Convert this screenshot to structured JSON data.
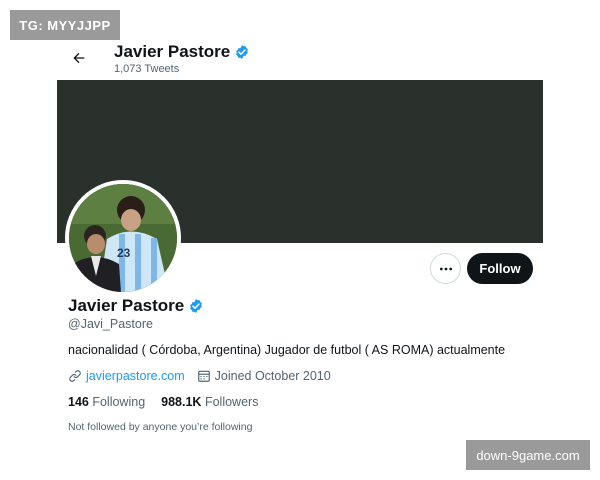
{
  "watermarks": {
    "top_left": "TG: MYYJJPP",
    "bottom_right": "down-9game.com"
  },
  "header": {
    "back_icon": "arrow-left-icon",
    "name": "Javier Pastore",
    "tweets_count": "1,073 Tweets",
    "verified_icon": "verified-badge-icon"
  },
  "profile": {
    "name": "Javier Pastore",
    "handle": "@Javi_Pastore",
    "bio": "nacionalidad ( Córdoba, Argentina) Jugador de futbol ( AS ROMA) actualmente",
    "website": "javierpastore.com",
    "joined": "Joined October 2010",
    "following_count": "146",
    "following_label": "Following",
    "followers_count": "988.1K",
    "followers_label": "Followers",
    "followed_note": "Not followed by anyone you’re following"
  },
  "actions": {
    "follow_label": "Follow",
    "more_icon": "more-horizontal-icon"
  },
  "colors": {
    "accent": "#1d9bf0",
    "banner": "#2a302b",
    "text": "#0f1419",
    "muted": "#536471",
    "follow_bg": "#0f1419"
  }
}
